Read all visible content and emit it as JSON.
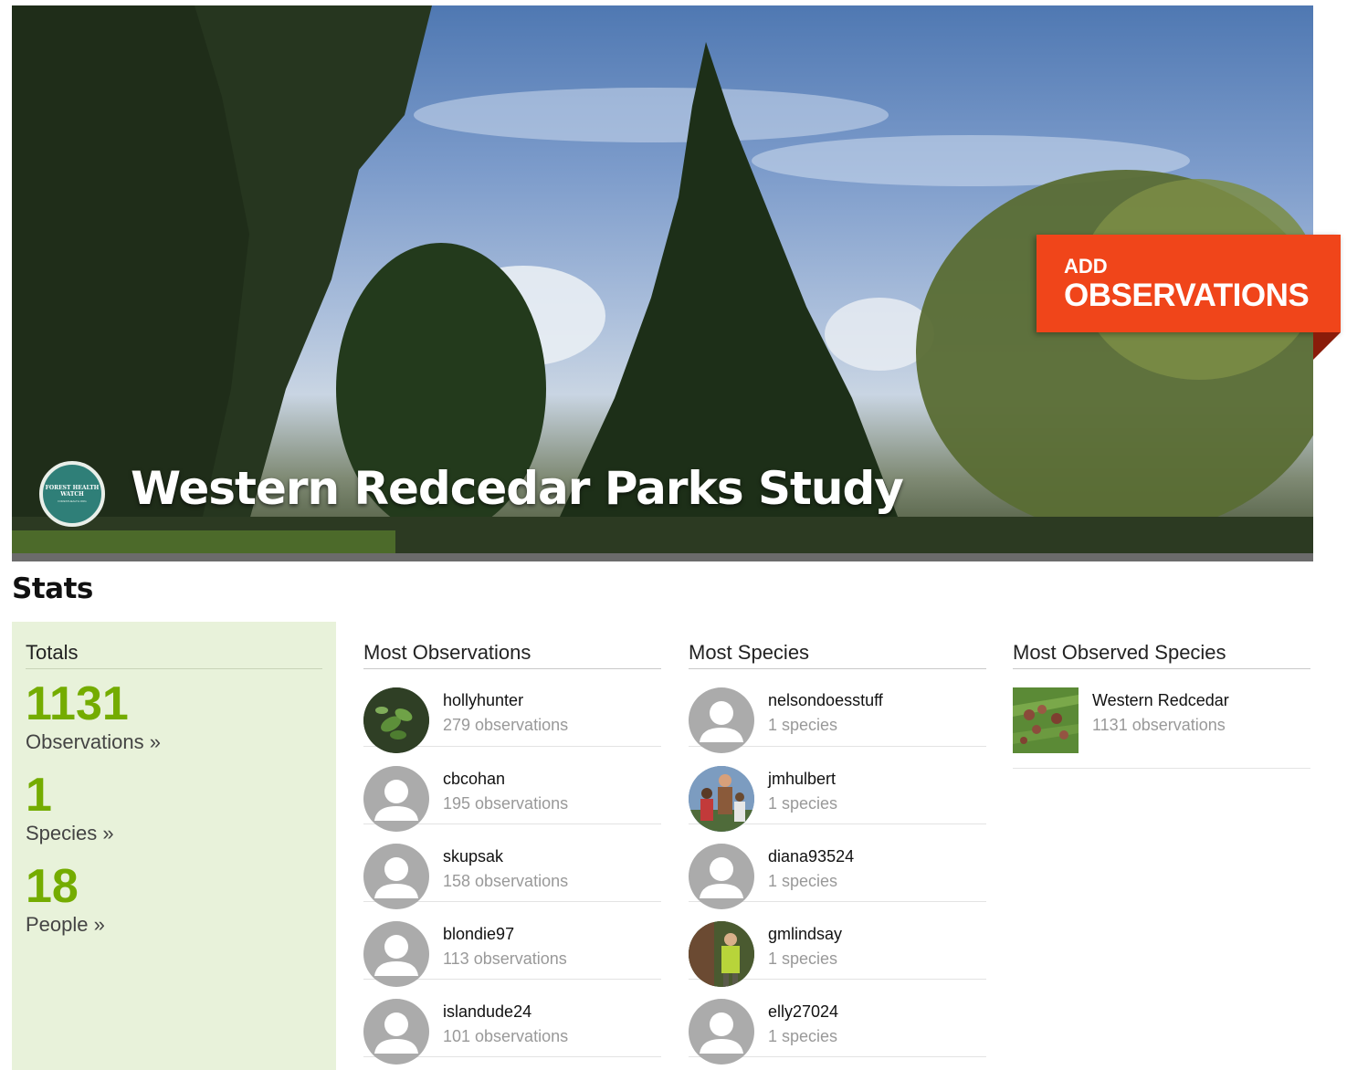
{
  "banner": {
    "title": "Western Redcedar Parks Study",
    "logo_text": "FOREST HEALTH WATCH",
    "logo_sub": "FORESTHEALTH.ORG"
  },
  "add_observations": {
    "line1": "ADD",
    "line2": "OBSERVATIONS"
  },
  "stats": {
    "title": "Stats",
    "totals": {
      "heading": "Totals",
      "items": [
        {
          "value": "1131",
          "label": "Observations »"
        },
        {
          "value": "1",
          "label": "Species »"
        },
        {
          "value": "18",
          "label": "People »"
        }
      ]
    },
    "most_observations": {
      "heading": "Most Observations",
      "rows": [
        {
          "name": "hollyhunter",
          "sub": "279 observations",
          "avatar": "photo-plant"
        },
        {
          "name": "cbcohan",
          "sub": "195 observations",
          "avatar": "default-user"
        },
        {
          "name": "skupsak",
          "sub": "158 observations",
          "avatar": "default-user"
        },
        {
          "name": "blondie97",
          "sub": "113 observations",
          "avatar": "default-user"
        },
        {
          "name": "islandude24",
          "sub": "101 observations",
          "avatar": "default-user"
        }
      ]
    },
    "most_species": {
      "heading": "Most Species",
      "rows": [
        {
          "name": "nelsondoesstuff",
          "sub": "1 species",
          "avatar": "default-user"
        },
        {
          "name": "jmhulbert",
          "sub": "1 species",
          "avatar": "photo-people"
        },
        {
          "name": "diana93524",
          "sub": "1 species",
          "avatar": "default-user"
        },
        {
          "name": "gmlindsay",
          "sub": "1 species",
          "avatar": "photo-person-tree"
        },
        {
          "name": "elly27024",
          "sub": "1 species",
          "avatar": "default-user"
        }
      ]
    },
    "most_observed_species": {
      "heading": "Most Observed Species",
      "rows": [
        {
          "name": "Western Redcedar",
          "sub": "1131 observations",
          "thumb": "redcedar-cones"
        }
      ]
    }
  }
}
